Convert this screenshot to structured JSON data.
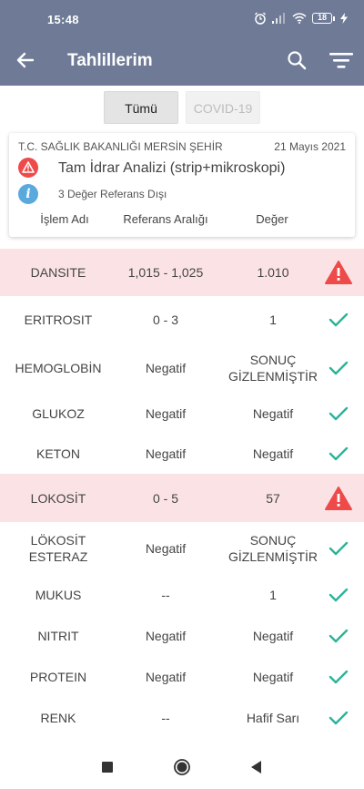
{
  "status_bar": {
    "time": "15:48",
    "battery": "18"
  },
  "app_bar": {
    "title": "Tahlillerim"
  },
  "tabs": [
    {
      "label": "Tümü"
    },
    {
      "label": "COVID-19"
    }
  ],
  "card": {
    "institution": "T.C. SAĞLIK BAKANLIĞI MERSİN ŞEHİR",
    "date": "21 Mayıs 2021",
    "test_name": "Tam İdrar Analizi (strip+mikroskopi)",
    "info_icon_letter": "i",
    "reference_info": "3 Değer Referans Dışı",
    "columns": {
      "name": "İşlem Adı",
      "range": "Referans Aralığı",
      "value": "Değer"
    }
  },
  "rows": [
    {
      "name": "DANSITE",
      "range": "1,015 - 1,025",
      "value": "1.010",
      "status": "alert"
    },
    {
      "name": "ERITROSIT",
      "range": "0 - 3",
      "value": "1",
      "status": "ok"
    },
    {
      "name": "HEMOGLOBİN",
      "range": "Negatif",
      "value": "SONUÇ GİZLENMİŞTİR",
      "status": "ok"
    },
    {
      "name": "GLUKOZ",
      "range": "Negatif",
      "value": "Negatif",
      "status": "ok"
    },
    {
      "name": "KETON",
      "range": "Negatif",
      "value": "Negatif",
      "status": "ok"
    },
    {
      "name": "LOKOSİT",
      "range": "0 - 5",
      "value": "57",
      "status": "alert"
    },
    {
      "name": "LÖKOSİT ESTERAZ",
      "range": "Negatif",
      "value": "SONUÇ GİZLENMİŞTİR",
      "status": "ok"
    },
    {
      "name": "MUKUS",
      "range": "--",
      "value": "1",
      "status": "ok"
    },
    {
      "name": "NITRIT",
      "range": "Negatif",
      "value": "Negatif",
      "status": "ok"
    },
    {
      "name": "PROTEIN",
      "range": "Negatif",
      "value": "Negatif",
      "status": "ok"
    },
    {
      "name": "RENK",
      "range": "--",
      "value": "Hafif Sarı",
      "status": "ok"
    }
  ],
  "colors": {
    "header": "#6f7a96",
    "alert_row": "#fbe3e5",
    "alert_icon": "#ef4a4a",
    "ok_check": "#2bb39a",
    "info_icon": "#5aa9de"
  },
  "icons": {
    "back": "arrow-left-icon",
    "search": "search-icon",
    "filter": "filter-icon",
    "alert": "warning-triangle-icon",
    "ok": "check-icon",
    "nav": [
      "square-icon",
      "circle-icon",
      "triangle-icon"
    ]
  }
}
